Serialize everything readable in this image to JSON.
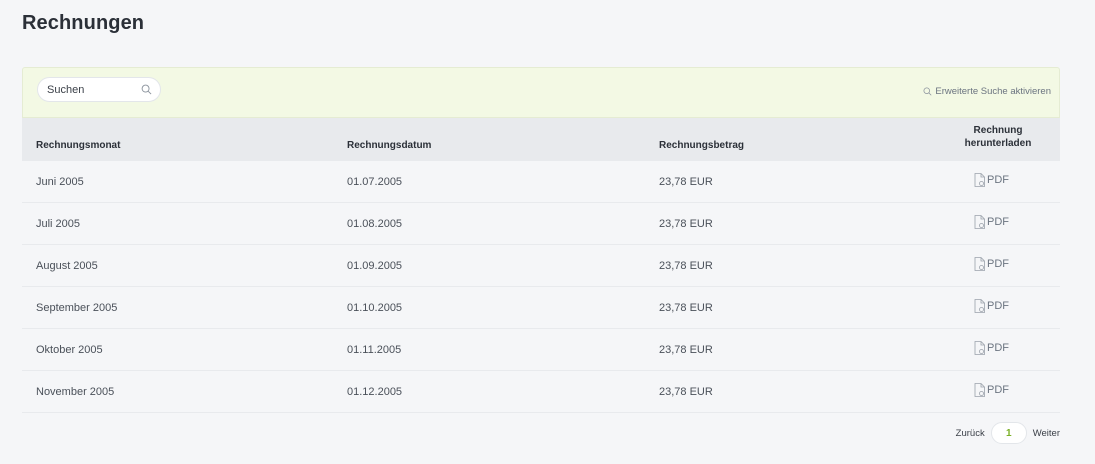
{
  "page": {
    "title": "Rechnungen"
  },
  "search": {
    "placeholder": "Suchen",
    "advanced_label": "Erweiterte Suche aktivieren"
  },
  "table": {
    "headers": {
      "month": "Rechnungsmonat",
      "date": "Rechnungsdatum",
      "amount": "Rechnungsbetrag",
      "download": "Rechnung herunterladen"
    },
    "rows": [
      {
        "month": "Juni 2005",
        "date": "01.07.2005",
        "amount": "23,78 EUR",
        "download": "PDF"
      },
      {
        "month": "Juli 2005",
        "date": "01.08.2005",
        "amount": "23,78 EUR",
        "download": "PDF"
      },
      {
        "month": "August 2005",
        "date": "01.09.2005",
        "amount": "23,78 EUR",
        "download": "PDF"
      },
      {
        "month": "September 2005",
        "date": "01.10.2005",
        "amount": "23,78 EUR",
        "download": "PDF"
      },
      {
        "month": "Oktober 2005",
        "date": "01.11.2005",
        "amount": "23,78 EUR",
        "download": "PDF"
      },
      {
        "month": "November 2005",
        "date": "01.12.2005",
        "amount": "23,78 EUR",
        "download": "PDF"
      }
    ]
  },
  "pagination": {
    "prev": "Zurück",
    "current": "1",
    "next": "Weiter"
  },
  "icons": {
    "search": "search-icon",
    "pdf": "pdf-file-icon"
  },
  "colors": {
    "accent": "#7bb027",
    "search_bar_bg": "#f3f9e4",
    "header_bg": "#e8eaed"
  }
}
